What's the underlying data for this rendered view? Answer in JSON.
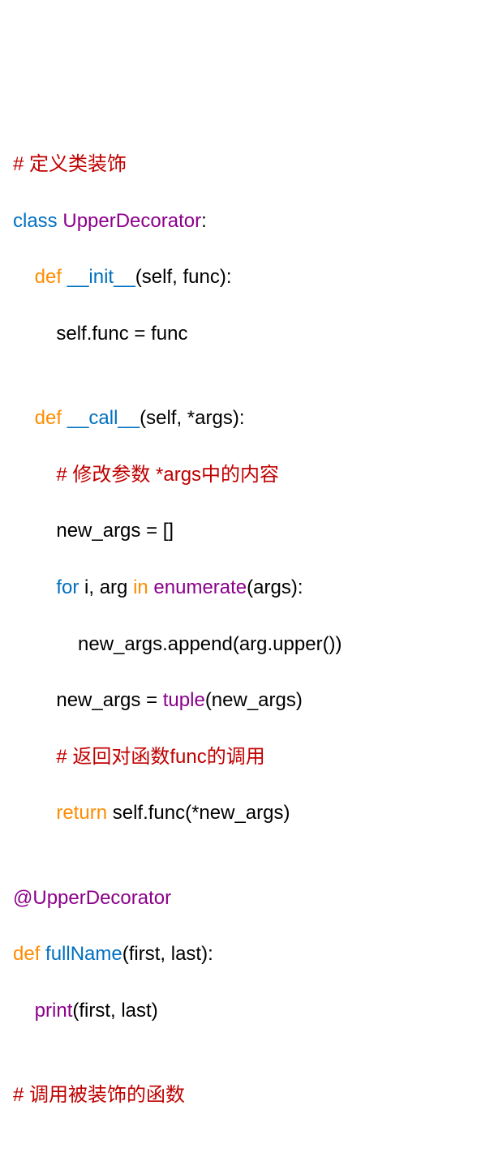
{
  "code": {
    "line1_comment": "# 定义类装饰",
    "line2_kw_class": "class",
    "line2_classname": " UpperDecorator",
    "line2_colon": ":",
    "line3_indent": "    ",
    "line3_kw_def": "def",
    "line3_funcname": " __init__",
    "line3_params": "(self, func):",
    "line4_body": "        self.func = func",
    "line5_blank": "",
    "line6_indent": "    ",
    "line6_kw_def": "def",
    "line6_funcname": " __call__",
    "line6_params": "(self, *args):",
    "line7_indent": "        ",
    "line7_comment": "# 修改参数 *args中的内容",
    "line8_body": "        new_args = []",
    "line9_indent": "        ",
    "line9_for": "for",
    "line9_mid": " i, arg ",
    "line9_in": "in",
    "line9_enum": " enumerate",
    "line9_end": "(args):",
    "line10_body": "            new_args.append(arg.upper())",
    "line11_indent": "        new_args = ",
    "line11_tuple": "tuple",
    "line11_end": "(new_args)",
    "line12_indent": "        ",
    "line12_comment": "# 返回对函数func的调用",
    "line13_indent": "        ",
    "line13_return": "return",
    "line13_end": " self.func(*new_args)",
    "line14_blank": "",
    "line15_deco": "@UpperDecorator",
    "line16_kw_def": "def",
    "line16_funcname": " fullName",
    "line16_params": "(first, last):",
    "line17_indent": "    ",
    "line17_print": "print",
    "line17_end": "(first, last)",
    "line18_blank": "",
    "line19_comment": "# 调用被装饰的函数"
  }
}
